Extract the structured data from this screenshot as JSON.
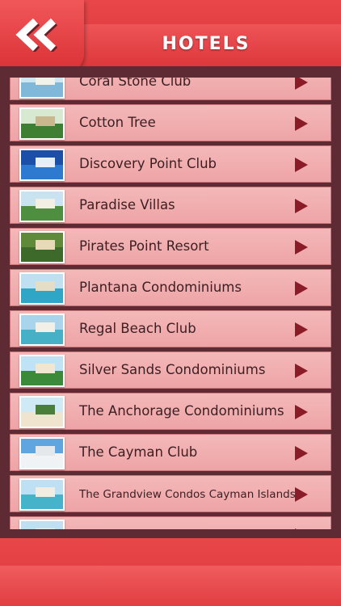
{
  "header": {
    "title": "HOTELS",
    "back_icon": "double-chevron-left-icon"
  },
  "colors": {
    "accent": "#e33b3e",
    "panel": "#5e2a34",
    "row": "#f1aeb0",
    "arrow": "#8a1c28"
  },
  "hotels": [
    {
      "label": "Coral Stone Club"
    },
    {
      "label": "Cotton Tree"
    },
    {
      "label": "Discovery Point Club"
    },
    {
      "label": "Paradise Villas"
    },
    {
      "label": "Pirates Point Resort"
    },
    {
      "label": "Plantana Condominiums"
    },
    {
      "label": "Regal Beach Club"
    },
    {
      "label": "Silver Sands Condominiums"
    },
    {
      "label": "The Anchorage Condominiums"
    },
    {
      "label": "The Cayman Club"
    },
    {
      "label": "The Grandview Condos Cayman Islands"
    },
    {
      "label": ""
    }
  ]
}
